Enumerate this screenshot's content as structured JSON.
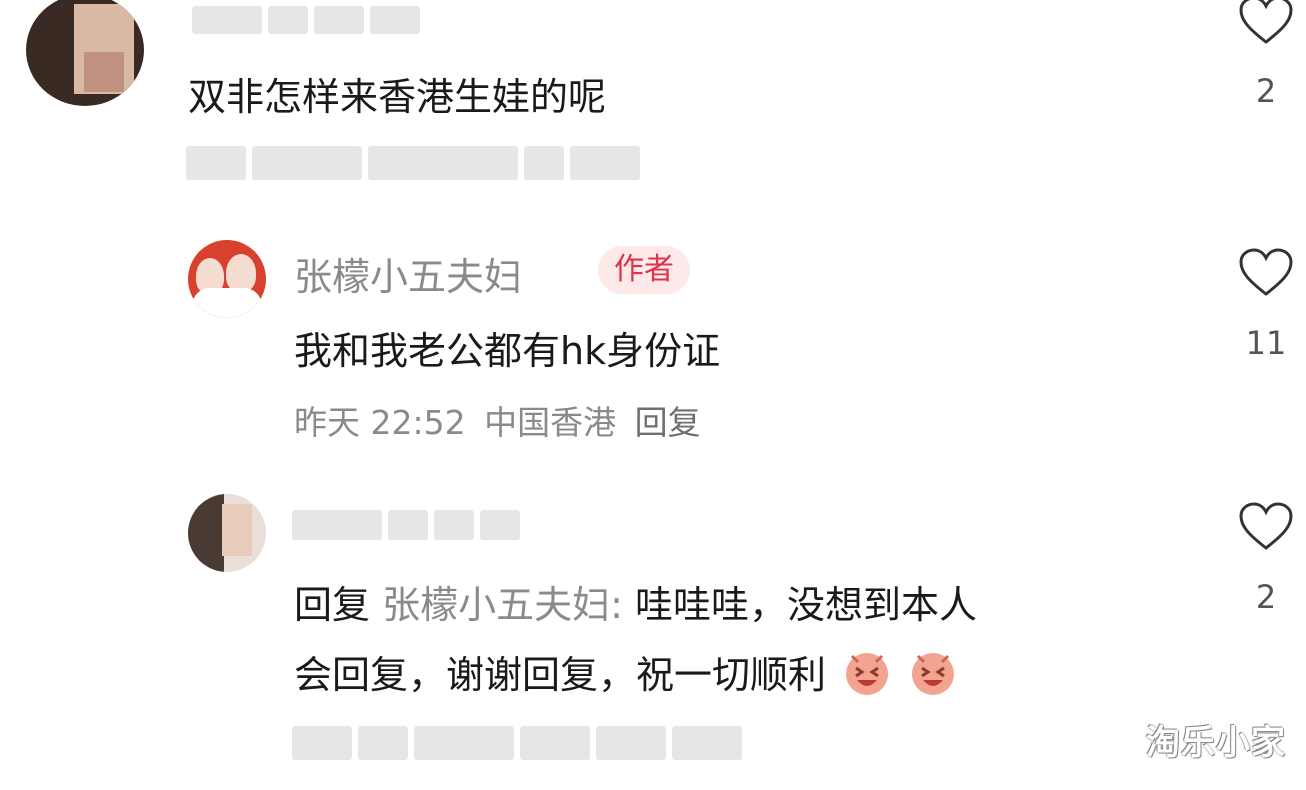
{
  "comments": [
    {
      "text": "双非怎样来香港生娃的呢",
      "likes": "2"
    },
    {
      "username": "张檬小五夫妇",
      "badge": "作者",
      "text": "我和我老公都有hk身份证",
      "meta": {
        "time": "昨天 22:52",
        "location": "中国香港",
        "reply_label": "回复"
      },
      "likes": "11"
    },
    {
      "reply_prefix": "回复",
      "reply_to": "张檬小五夫妇:",
      "text_line1": "哇哇哇，没想到本人",
      "text_line2": "会回复，谢谢回复，祝一切顺利",
      "likes": "2"
    }
  ],
  "watermark": "淘乐小家",
  "colors": {
    "badge_bg": "#fde8ea",
    "badge_text": "#e0334a",
    "meta_text": "#8a8a8a"
  },
  "icons": [
    "heart-outline-icon",
    "emoji-laugh-icon"
  ]
}
